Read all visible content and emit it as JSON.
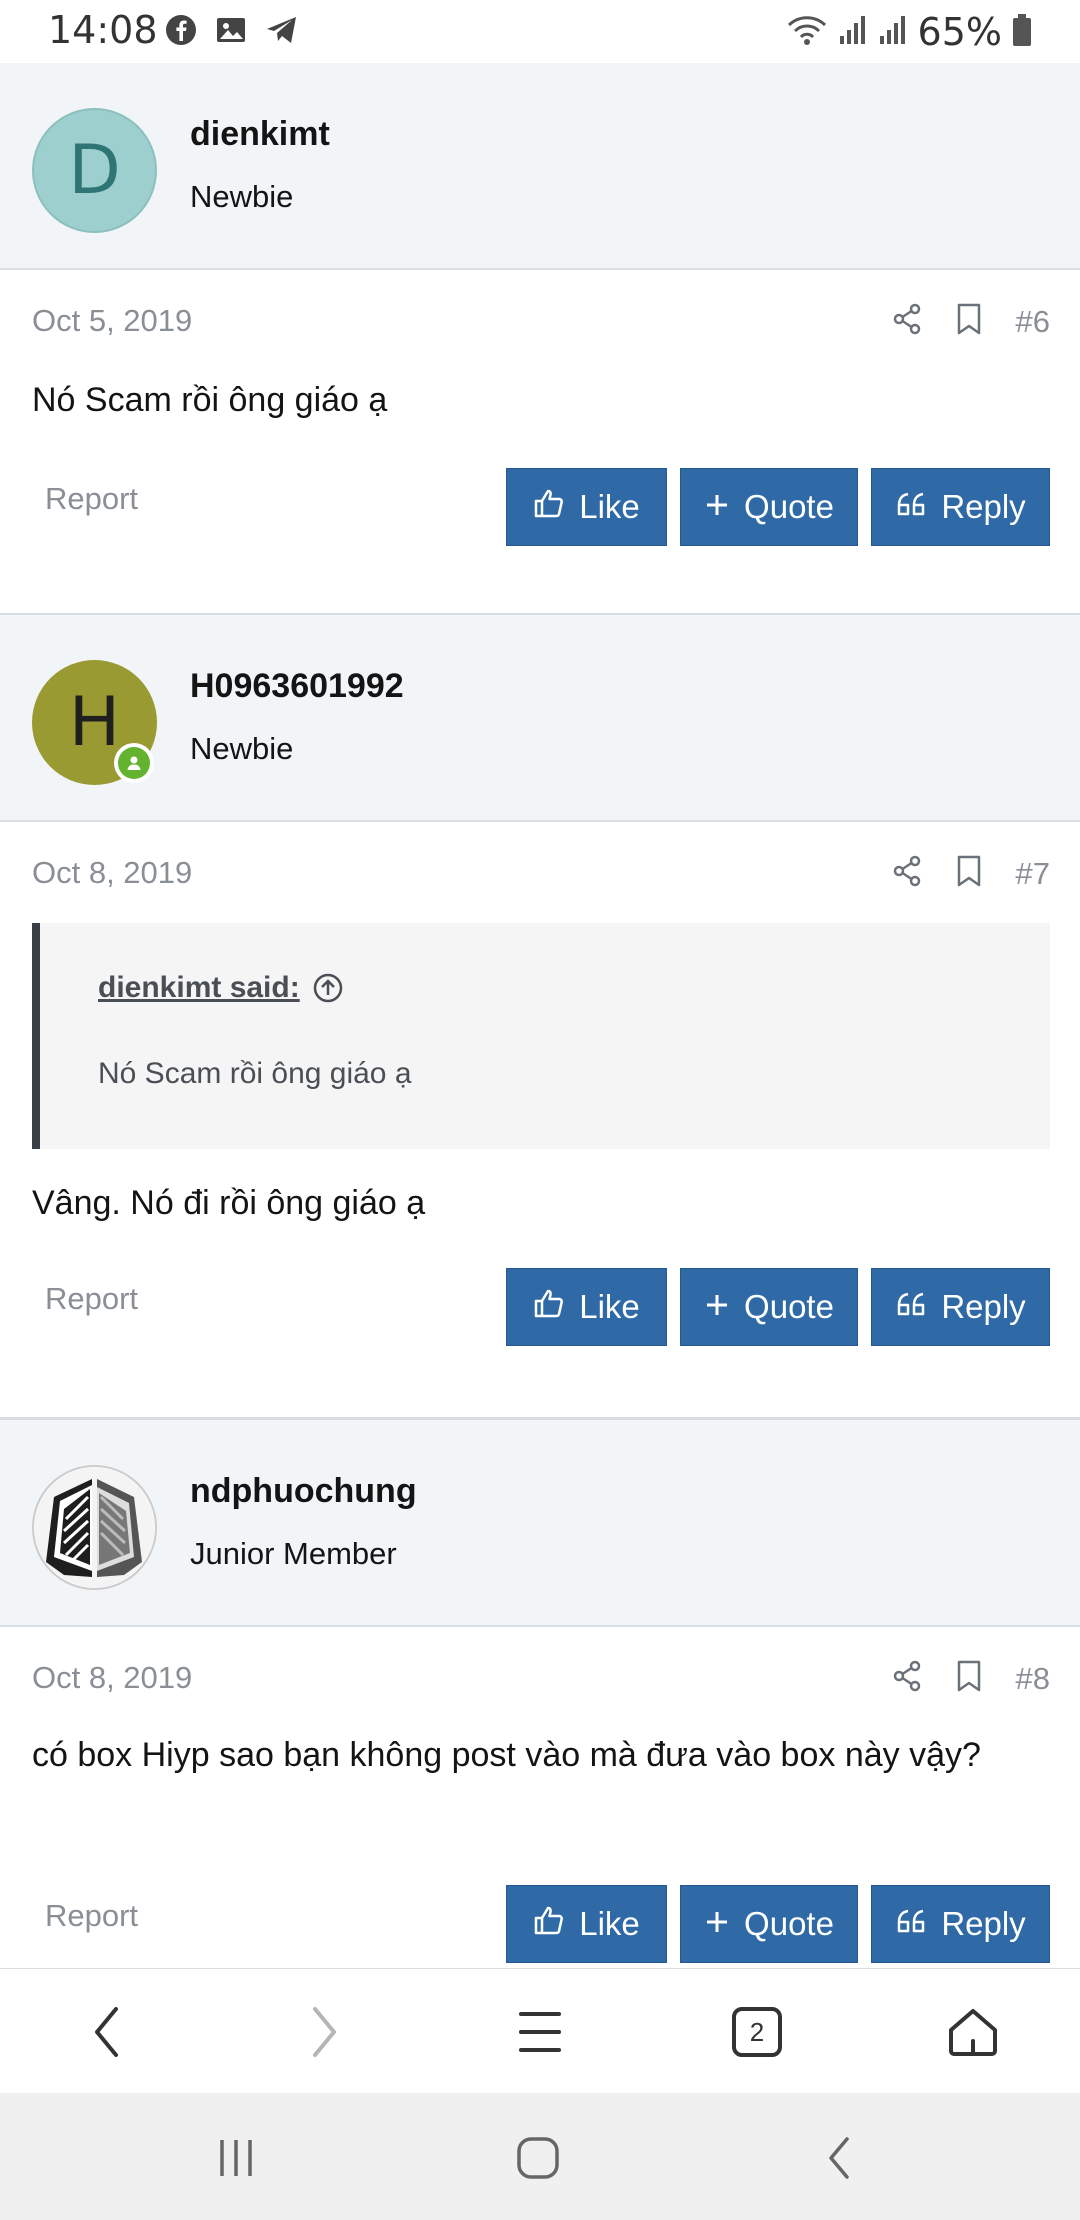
{
  "status_bar": {
    "time": "14:08",
    "left_icons": [
      "facebook-icon",
      "gallery-icon",
      "telegram-icon"
    ],
    "right_icons": [
      "wifi-icon",
      "signal-icon",
      "signal-icon"
    ],
    "battery": "65%"
  },
  "posts": [
    {
      "username": "dienkimt",
      "user_title": "Newbie",
      "avatar_letter": "D",
      "avatar_color": "#9ecfcf",
      "avatar_text_color": "#2f7573",
      "date": "Oct 5, 2019",
      "number": "#6",
      "content": "Nó Scam rồi ông giáo ạ",
      "report": "Report",
      "like": "Like",
      "quote": "Quote",
      "reply": "Reply"
    },
    {
      "username": "H0963601992",
      "user_title": "Newbie",
      "avatar_letter": "H",
      "avatar_color": "#9a9a33",
      "avatar_text_color": "#1f1f1f",
      "online": true,
      "date": "Oct 8, 2019",
      "number": "#7",
      "quote_author": "dienkimt said:",
      "quote_text": "Nó Scam rồi ông giáo ạ",
      "content": "Vâng. Nó đi rồi ông giáo ạ",
      "report": "Report",
      "like": "Like",
      "quote": "Quote",
      "reply": "Reply"
    },
    {
      "username": "ndphuochung",
      "user_title": "Junior Member",
      "avatar_image": "wings-emblem",
      "date": "Oct 8, 2019",
      "number": "#8",
      "content": "có box Hiyp sao bạn không post vào mà đưa vào box này vậy?",
      "report": "Report",
      "like": "Like",
      "quote": "Quote",
      "reply": "Reply"
    }
  ],
  "browser_bar": {
    "items": [
      "back-icon",
      "forward-icon",
      "menu-icon",
      "tabs-icon",
      "home-icon"
    ],
    "tab_count": "2"
  },
  "system_nav": [
    "recents-icon",
    "home-icon",
    "back-icon"
  ],
  "colors": {
    "button": "#2f6aa6",
    "user_bg": "#f2f5f8",
    "meta_text": "#8a8f96",
    "online": "#63b32e"
  }
}
